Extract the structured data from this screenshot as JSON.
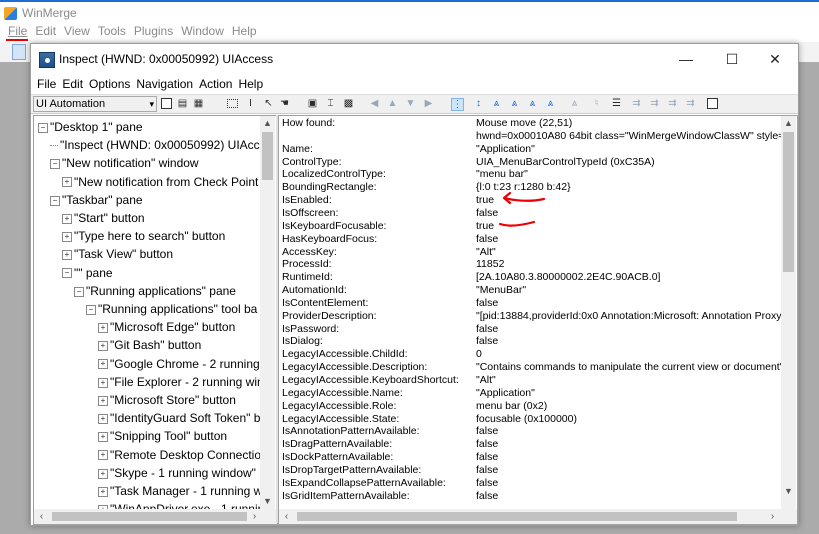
{
  "wm": {
    "title": "WinMerge",
    "menu": [
      "File",
      "Edit",
      "View",
      "Tools",
      "Plugins",
      "Window",
      "Help"
    ]
  },
  "inspect": {
    "title": "Inspect  (HWND: 0x00050992) UIAccess",
    "controls": {
      "minimize": "—",
      "maximize": "☐",
      "close": "✕"
    },
    "menu": [
      "File",
      "Edit",
      "Options",
      "Navigation",
      "Action",
      "Help"
    ],
    "mode": "UI Automation",
    "toolbar_icons": [
      "copy-icon",
      "paste-icon",
      "settings-icon",
      "highlight-rect-icon",
      "text-cursor-icon",
      "pointer-icon",
      "hover-icon",
      "focus-rect-icon",
      "caret-icon",
      "events-icon",
      "nav-left-icon",
      "nav-up-icon",
      "nav-down-icon",
      "nav-right-icon",
      "tree-icon",
      "child-icon",
      "parent-icon",
      "sibling-icon",
      "first-icon",
      "last-icon",
      "refresh-icon",
      "action-icon",
      "properties-icon"
    ],
    "tree": [
      {
        "label": "\"Desktop 1\" pane",
        "indent": 0,
        "type": "minus"
      },
      {
        "label": "\"Inspect  (HWND: 0x00050992) UIAcc",
        "indent": 1,
        "type": "leaf"
      },
      {
        "label": "\"New notification\" window",
        "indent": 1,
        "type": "minus"
      },
      {
        "label": "\"New notification from Check Point",
        "indent": 2,
        "type": "plus"
      },
      {
        "label": "\"Taskbar\" pane",
        "indent": 1,
        "type": "minus"
      },
      {
        "label": "\"Start\" button",
        "indent": 2,
        "type": "plus"
      },
      {
        "label": "\"Type here to search\" button",
        "indent": 2,
        "type": "plus"
      },
      {
        "label": "\"Task View\" button",
        "indent": 2,
        "type": "plus"
      },
      {
        "label": "\"\" pane",
        "indent": 2,
        "type": "minus"
      },
      {
        "label": "\"Running applications\" pane",
        "indent": 3,
        "type": "minus"
      },
      {
        "label": "\"Running applications\" tool ba",
        "indent": 4,
        "type": "minus"
      },
      {
        "label": "\"Microsoft Edge\" button",
        "indent": 5,
        "type": "plus"
      },
      {
        "label": "\"Git Bash\" button",
        "indent": 5,
        "type": "plus"
      },
      {
        "label": "\"Google Chrome - 2 running",
        "indent": 5,
        "type": "plus"
      },
      {
        "label": "\"File Explorer - 2 running win",
        "indent": 5,
        "type": "plus"
      },
      {
        "label": "\"Microsoft Store\" button",
        "indent": 5,
        "type": "plus"
      },
      {
        "label": "\"IdentityGuard Soft Token\" b",
        "indent": 5,
        "type": "plus"
      },
      {
        "label": "\"Snipping Tool\" button",
        "indent": 5,
        "type": "plus"
      },
      {
        "label": "\"Remote Desktop Connectio",
        "indent": 5,
        "type": "plus"
      },
      {
        "label": "\"Skype - 1 running window\"",
        "indent": 5,
        "type": "plus"
      },
      {
        "label": "\"Task Manager - 1 running w",
        "indent": 5,
        "type": "plus"
      },
      {
        "label": "\"WinAppDriver.exe - 1 runnin",
        "indent": 5,
        "type": "plus"
      }
    ],
    "properties": [
      {
        "key": "How found:",
        "value": "Mouse move (22,51)"
      },
      {
        "key": "",
        "value": "hwnd=0x00010A80 64bit class=\"WinMergeWindowClassW\" style=0"
      },
      {
        "key": "Name:",
        "value": "\"Application\""
      },
      {
        "key": "ControlType:",
        "value": "UIA_MenuBarControlTypeId (0xC35A)"
      },
      {
        "key": "LocalizedControlType:",
        "value": "\"menu bar\""
      },
      {
        "key": "BoundingRectangle:",
        "value": "{l:0 t:23 r:1280 b:42}"
      },
      {
        "key": "IsEnabled:",
        "value": "true"
      },
      {
        "key": "IsOffscreen:",
        "value": "false"
      },
      {
        "key": "IsKeyboardFocusable:",
        "value": "true"
      },
      {
        "key": "HasKeyboardFocus:",
        "value": "false"
      },
      {
        "key": "AccessKey:",
        "value": "\"Alt\""
      },
      {
        "key": "ProcessId:",
        "value": "11852"
      },
      {
        "key": "RuntimeId:",
        "value": "[2A.10A80.3.80000002.2E4C.90ACB.0]"
      },
      {
        "key": "AutomationId:",
        "value": "\"MenuBar\""
      },
      {
        "key": "IsContentElement:",
        "value": "false"
      },
      {
        "key": "ProviderDescription:",
        "value": "\"[pid:13884,providerId:0x0 Annotation:Microsoft: Annotation Proxy"
      },
      {
        "key": "IsPassword:",
        "value": "false"
      },
      {
        "key": "IsDialog:",
        "value": "false"
      },
      {
        "key": "LegacyIAccessible.ChildId:",
        "value": "0"
      },
      {
        "key": "LegacyIAccessible.Description:",
        "value": "\"Contains commands to manipulate the current view or document\""
      },
      {
        "key": "LegacyIAccessible.KeyboardShortcut:",
        "value": "\"Alt\""
      },
      {
        "key": "LegacyIAccessible.Name:",
        "value": "\"Application\""
      },
      {
        "key": "LegacyIAccessible.Role:",
        "value": "menu bar (0x2)"
      },
      {
        "key": "LegacyIAccessible.State:",
        "value": "focusable (0x100000)"
      },
      {
        "key": "IsAnnotationPatternAvailable:",
        "value": "false"
      },
      {
        "key": "IsDragPatternAvailable:",
        "value": "false"
      },
      {
        "key": "IsDockPatternAvailable:",
        "value": "false"
      },
      {
        "key": "IsDropTargetPatternAvailable:",
        "value": "false"
      },
      {
        "key": "IsExpandCollapsePatternAvailable:",
        "value": "false"
      },
      {
        "key": "IsGridItemPatternAvailable:",
        "value": "false"
      }
    ]
  }
}
